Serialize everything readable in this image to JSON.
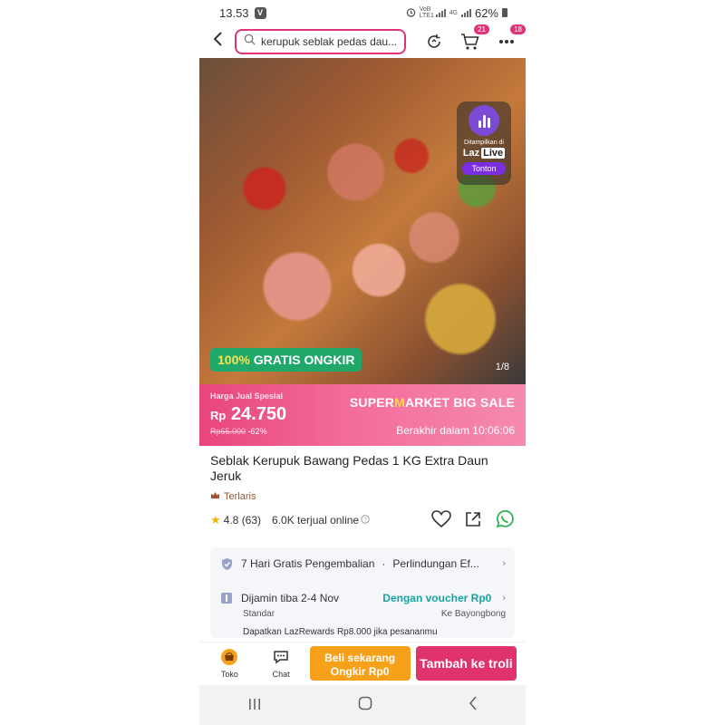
{
  "status_bar": {
    "time": "13.53",
    "volte": "VoB LTE1",
    "network": "4G",
    "battery": "62%"
  },
  "nav": {
    "search_value": "kerupuk seblak pedas dau...",
    "cart_count": "21",
    "more_count": "18"
  },
  "hero": {
    "live_caption": "Ditampilkan di",
    "live_brand": "Laz",
    "live_brand_tag": "Live",
    "live_button": "Tonton",
    "ongkir_pct": "100%",
    "ongkir_text": "GRATIS ONGKIR",
    "image_counter": "1/8"
  },
  "price": {
    "label": "Harga Jual Spesial",
    "currency": "Rp",
    "value": "24.750",
    "original": "Rp65.000",
    "discount": "-62%",
    "brand_super": "SUPER",
    "brand_m": "M",
    "brand_rest": "ARKET BIG SALE",
    "ends_label": "Berakhir dalam 10:06:06"
  },
  "product": {
    "title": "Seblak Kerupuk Bawang Pedas 1 KG Extra Daun Jeruk",
    "badge": "Terlaris",
    "rating": "4.8",
    "review_count": "(63)",
    "sold_online": "6.0K terjual online"
  },
  "info": {
    "returns": "7 Hari Gratis Pengembalian",
    "protection": "Perlindungan Ef...",
    "delivery": "Dijamin tiba 2-4 Nov",
    "voucher": "Dengan voucher Rp0",
    "shipping_type": "Standar",
    "destination": "Ke Bayongbong",
    "rewards": "Dapatkan LazRewards Rp8.000 jika pesananmu"
  },
  "bottom": {
    "store": "Toko",
    "chat": "Chat",
    "buy_now_line1": "Beli sekarang",
    "buy_now_line2": "Ongkir Rp0",
    "add_cart": "Tambah ke troli"
  },
  "colors": {
    "accent": "#e0337a",
    "price_banner": "#f36b9b",
    "buy": "#f7a11a",
    "cart": "#e0336b",
    "green": "#1fa86a"
  }
}
